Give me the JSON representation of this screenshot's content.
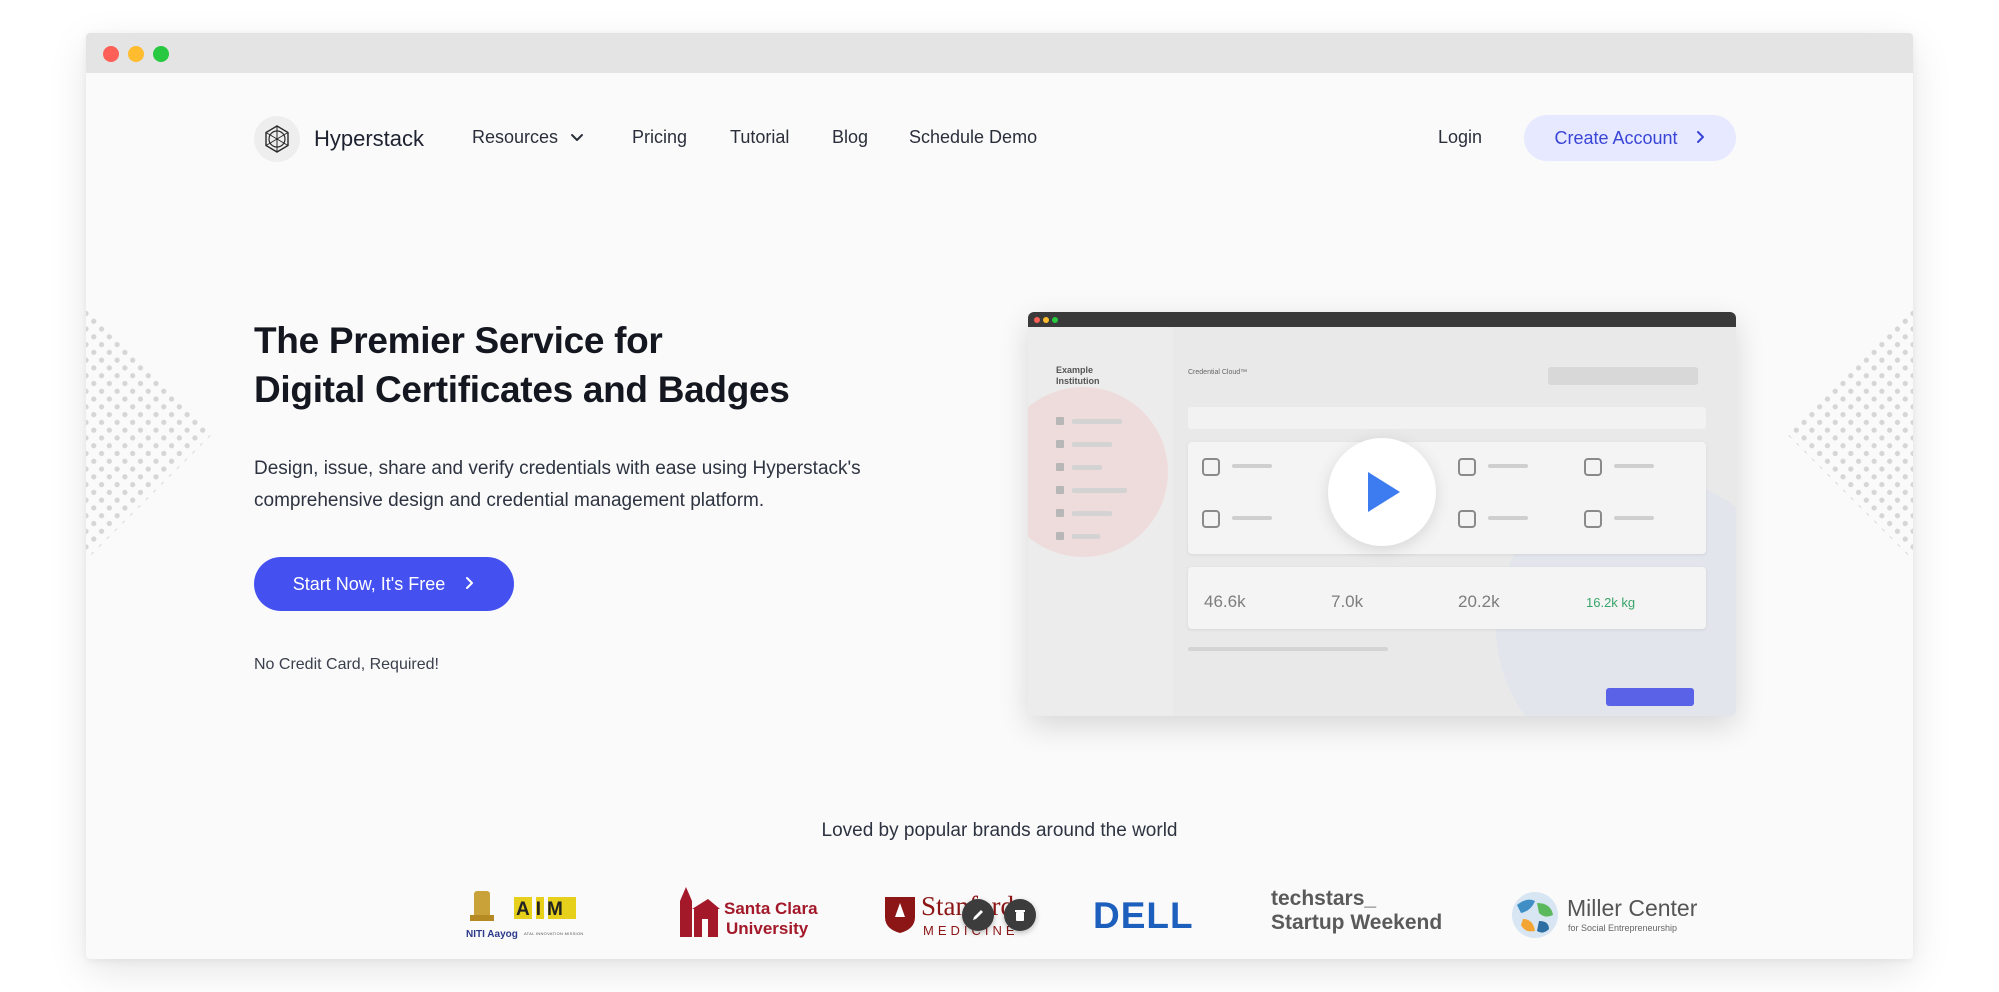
{
  "brand": {
    "name": "Hyperstack"
  },
  "nav": {
    "resources": "Resources",
    "pricing": "Pricing",
    "tutorial": "Tutorial",
    "blog": "Blog",
    "schedule_demo": "Schedule Demo",
    "login": "Login",
    "create_account": "Create Account"
  },
  "hero": {
    "title_line1": "The Premier Service for",
    "title_line2": "Digital Certificates and Badges",
    "subtitle": "Design, issue, share and verify credentials with ease using Hyperstack's comprehensive design and credential management platform.",
    "cta": "Start Now, It's Free",
    "note": "No Credit Card, Required!"
  },
  "video_preview": {
    "institution": "Example Institution",
    "product": "Credential Cloud™",
    "stats": [
      "46.6k",
      "7.0k",
      "20.2k",
      "16.2k kg"
    ]
  },
  "brands_section": {
    "heading": "Loved by popular brands around the world",
    "logos": [
      {
        "icon": "niti-aayog-aim-logo",
        "line1": "NITI Aayog",
        "line2": "AIM",
        "line3": "ATAL INNOVATION MISSION"
      },
      {
        "icon": "santa-clara-university-logo",
        "line1": "Santa Clara",
        "line2": "University"
      },
      {
        "icon": "stanford-medicine-logo",
        "line1": "Stanford",
        "line2": "MEDICINE"
      },
      {
        "icon": "dell-logo",
        "line1": "DELL"
      },
      {
        "icon": "techstars-startup-weekend-logo",
        "line1": "techstars_",
        "line2": "Startup Weekend"
      },
      {
        "icon": "miller-center-logo",
        "line1": "Miller Center",
        "line2": "for Social Entrepreneurship"
      }
    ]
  },
  "colors": {
    "primary": "#4450f0",
    "primary_soft": "#e6e9ff",
    "primary_text": "#3a45d6",
    "title_text": "#14171f",
    "window_titlebar": "#e4e4e4"
  }
}
